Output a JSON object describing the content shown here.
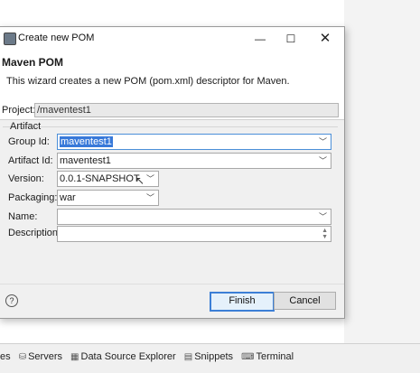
{
  "background_tabs": [
    {
      "icon": "problems-icon",
      "label": "es"
    },
    {
      "icon": "servers-icon",
      "label": "Servers"
    },
    {
      "icon": "data-source-explorer-icon",
      "label": "Data Source Explorer"
    },
    {
      "icon": "snippets-icon",
      "label": "Snippets"
    },
    {
      "icon": "terminal-icon",
      "label": "Terminal"
    }
  ],
  "dialog": {
    "title": "Create new POM",
    "controls": {
      "minimize": "—",
      "maximize": "☐",
      "close": "✕"
    },
    "header": {
      "title": "Maven POM",
      "description": "This wizard creates a new POM (pom.xml) descriptor for Maven."
    },
    "project": {
      "label": "Project:",
      "value": "/maventest1"
    },
    "artifact_group": "Artifact",
    "fields": {
      "group_id": {
        "label": "Group Id:",
        "value": "maventest1"
      },
      "artifact_id": {
        "label": "Artifact Id:",
        "value": "maventest1"
      },
      "version": {
        "label": "Version:",
        "value": "0.0.1-SNAPSHOT"
      },
      "packaging": {
        "label": "Packaging:",
        "value": "war"
      },
      "name": {
        "label": "Name:",
        "value": ""
      },
      "description": {
        "label": "Description:",
        "value": ""
      }
    },
    "buttons": {
      "finish": "Finish",
      "cancel": "Cancel",
      "help": "?"
    }
  }
}
